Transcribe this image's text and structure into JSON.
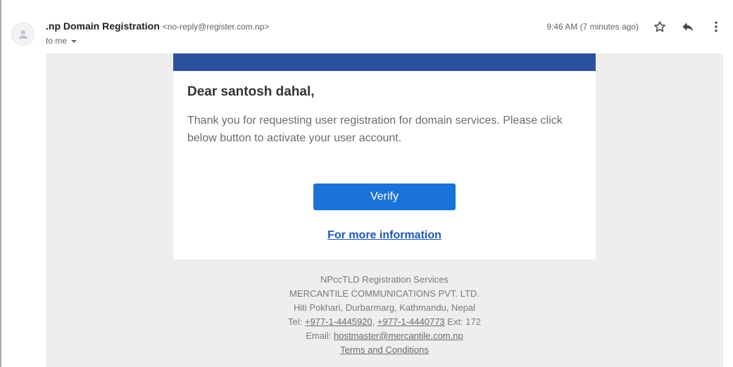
{
  "header": {
    "sender_name": ".np Domain Registration",
    "sender_email": "<no-reply@register.com.np>",
    "recipient": "to me",
    "timestamp": "9:46 AM (7 minutes ago)"
  },
  "icons": {
    "avatar": "person-icon",
    "star": "star-icon",
    "reply": "reply-icon",
    "more": "more-vert-icon"
  },
  "email": {
    "greeting": "Dear santosh dahal,",
    "message": "Thank you for requesting user registration for domain services. Please click below button to activate your user account.",
    "verify_label": "Verify",
    "more_info_label": "For more information",
    "banner_color": "#2c529e",
    "button_color": "#1a73d8"
  },
  "footer": {
    "line1": "NPccTLD Registration Services",
    "line2": "MERCANTILE COMMUNICATIONS PVT. LTD.",
    "line3": "Hiti Pokhari, Durbarmarg, Kathmandu, Nepal",
    "tel_label": "Tel: ",
    "phone1": "+977-1-4445920",
    "phone_sep": ", ",
    "phone2": "+977-1-4440773",
    "ext": " Ext: 172",
    "email_label": "Email: ",
    "email": "hostmaster@mercantile.com.np",
    "terms": "Terms and Conditions"
  }
}
